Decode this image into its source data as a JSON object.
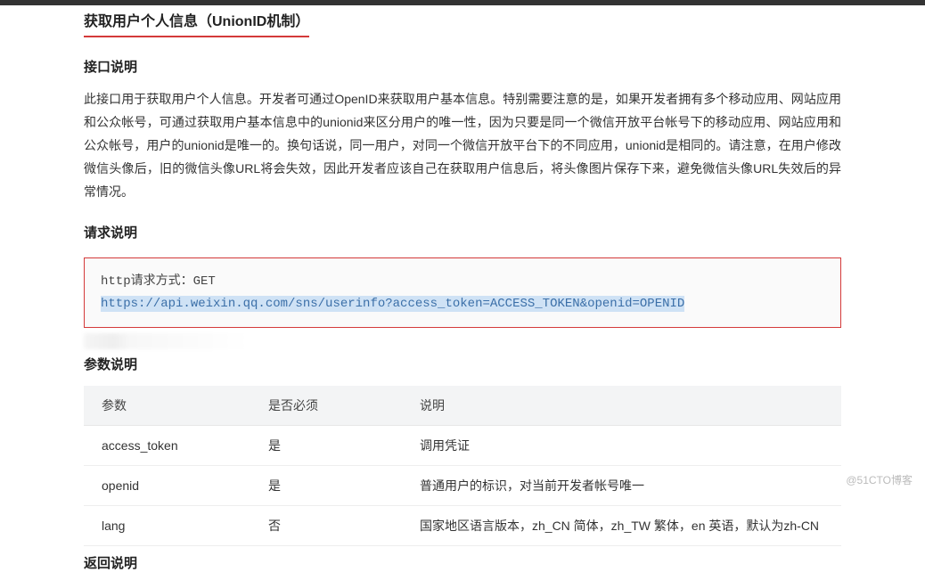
{
  "title": "获取用户个人信息（UnionID机制）",
  "interfaceHeading": "接口说明",
  "interfaceDesc": "此接口用于获取用户个人信息。开发者可通过OpenID来获取用户基本信息。特别需要注意的是，如果开发者拥有多个移动应用、网站应用和公众帐号，可通过获取用户基本信息中的unionid来区分用户的唯一性，因为只要是同一个微信开放平台帐号下的移动应用、网站应用和公众帐号，用户的unionid是唯一的。换句话说，同一用户，对同一个微信开放平台下的不同应用，unionid是相同的。请注意，在用户修改微信头像后，旧的微信头像URL将会失效，因此开发者应该自己在获取用户信息后，将头像图片保存下来，避免微信头像URL失效后的异常情况。",
  "requestHeading": "请求说明",
  "codeLine1": "http请求方式：GET",
  "codeLine2": "https://api.weixin.qq.com/sns/userinfo?access_token=ACCESS_TOKEN&openid=OPENID",
  "paramsHeading": "参数说明",
  "tableHeaders": {
    "col1": "参数",
    "col2": "是否必须",
    "col3": "说明"
  },
  "tableRows": [
    {
      "param": "access_token",
      "required": "是",
      "desc": "调用凭证"
    },
    {
      "param": "openid",
      "required": "是",
      "desc": "普通用户的标识，对当前开发者帐号唯一"
    },
    {
      "param": "lang",
      "required": "否",
      "desc": "国家地区语言版本，zh_CN 简体，zh_TW 繁体，en 英语，默认为zh-CN"
    }
  ],
  "returnHeading": "返回说明",
  "watermark": "@51CTO博客"
}
